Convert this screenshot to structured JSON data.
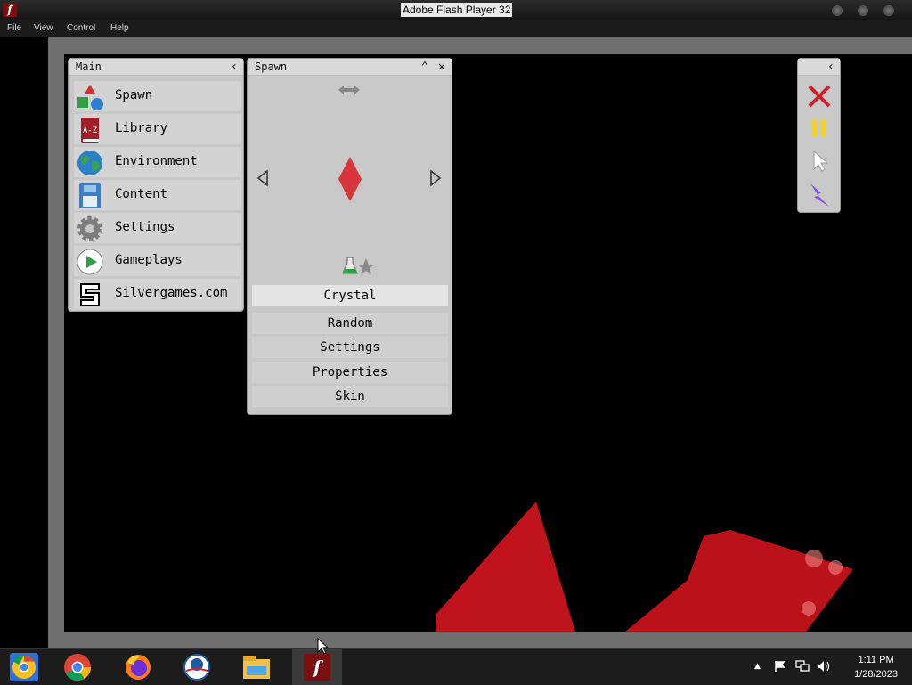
{
  "window": {
    "title": "Adobe Flash Player 32"
  },
  "menubar": [
    "File",
    "View",
    "Control",
    "Help"
  ],
  "main_panel": {
    "title": "Main",
    "items": [
      {
        "label": "Spawn",
        "icon": "shapes-icon"
      },
      {
        "label": "Library",
        "icon": "book-icon"
      },
      {
        "label": "Environment",
        "icon": "globe-icon"
      },
      {
        "label": "Content",
        "icon": "floppy-disk-icon"
      },
      {
        "label": "Settings",
        "icon": "gear-icon"
      },
      {
        "label": "Gameplays",
        "icon": "play-icon"
      },
      {
        "label": "Silvergames.com",
        "icon": "silvergames-logo-icon"
      }
    ]
  },
  "spawn_panel": {
    "title": "Spawn",
    "selected_item": "Crystal",
    "buttons": [
      "Random",
      "Settings",
      "Properties",
      "Skin"
    ]
  },
  "taskbar": {
    "time": "1:11 PM",
    "date": "1/28/2023"
  },
  "colors": {
    "crystal": "#d8353a",
    "debris": "#c0131c",
    "panel": "#c8c8c8",
    "accent_yellow": "#f0d030",
    "accent_purple": "#8a4ad8"
  }
}
